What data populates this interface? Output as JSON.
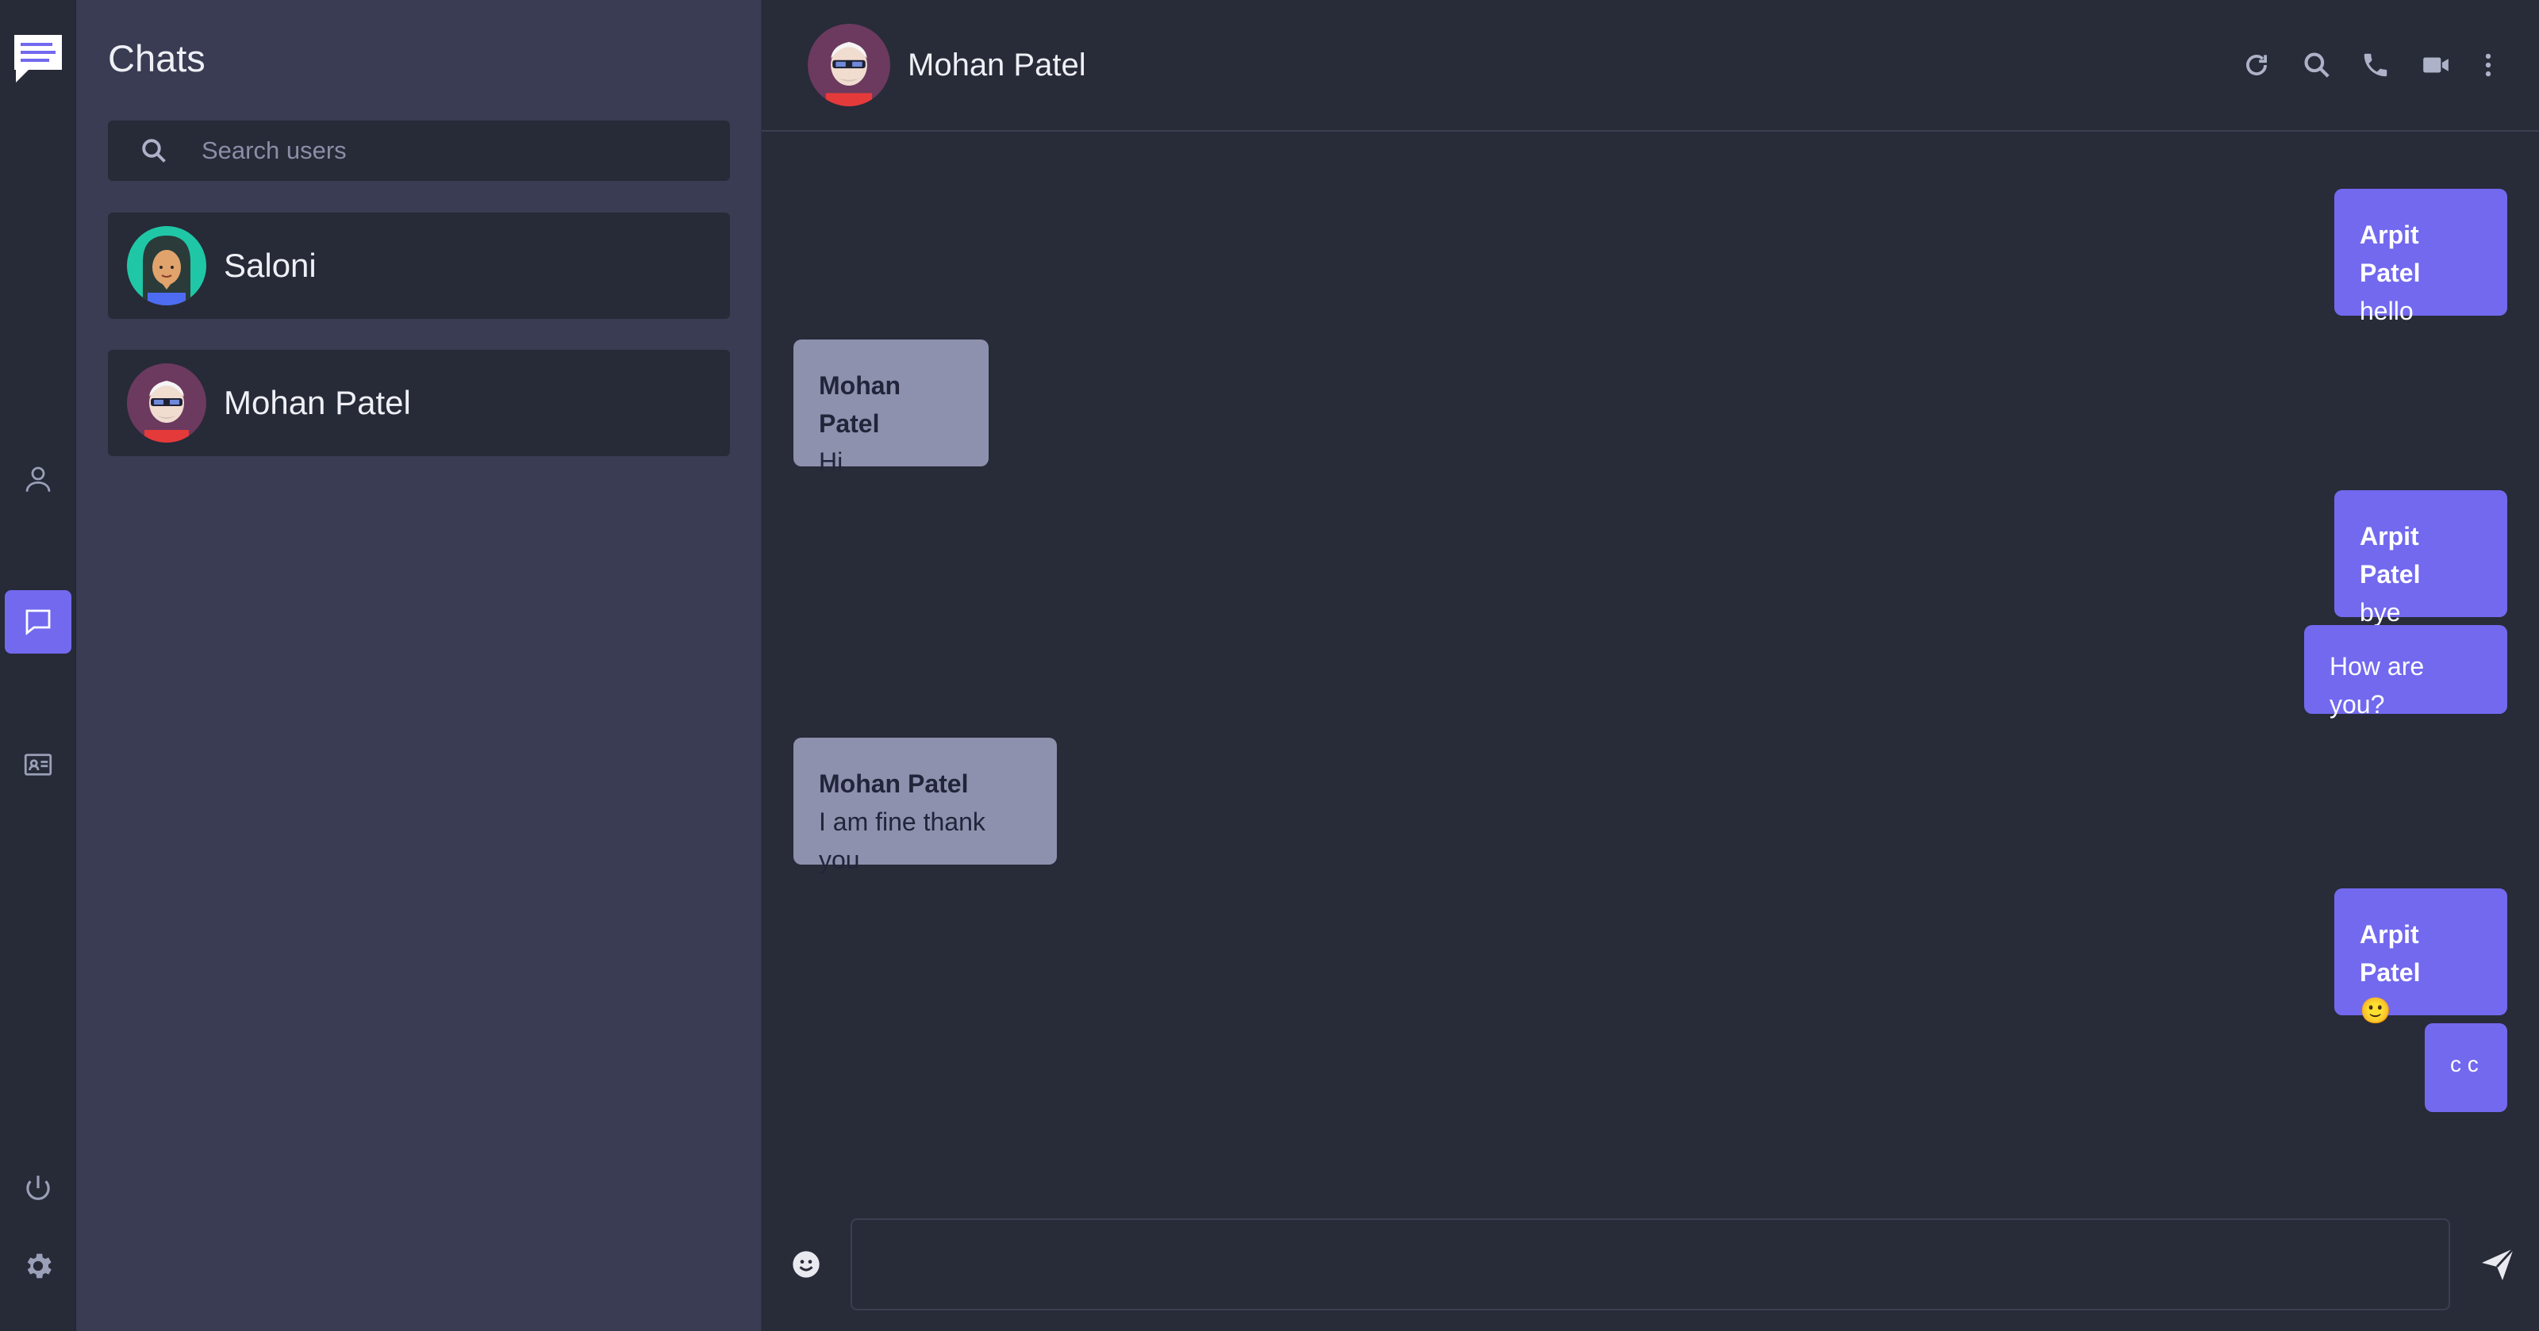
{
  "sidebar_rail": {
    "logo": "chat-logo-icon",
    "items": [
      {
        "icon": "user-icon",
        "active": false
      },
      {
        "icon": "chat-icon",
        "active": true
      },
      {
        "icon": "contacts-card-icon",
        "active": false
      },
      {
        "icon": "power-icon",
        "active": false
      },
      {
        "icon": "gear-icon",
        "active": false
      }
    ],
    "accent": "#7269ef"
  },
  "chat_list": {
    "title": "Chats",
    "search_placeholder": "Search users",
    "contacts": [
      {
        "name": "Saloni",
        "avatar": "avatar-female-icon"
      },
      {
        "name": "Mohan Patel",
        "avatar": "avatar-male-sunglasses-icon"
      }
    ]
  },
  "conversation": {
    "contact_name": "Mohan Patel",
    "header_icons": [
      "refresh-icon",
      "search-icon",
      "phone-icon",
      "video-icon",
      "more-vertical-icon"
    ],
    "messages": [
      {
        "direction": "out",
        "sender": "Arpit Patel",
        "text": "hello"
      },
      {
        "direction": "in",
        "sender": "Mohan Patel",
        "text": "Hi"
      },
      {
        "direction": "out",
        "sender": "Arpit Patel",
        "text": "bye"
      },
      {
        "direction": "out",
        "sender": "",
        "text": "How are you?"
      },
      {
        "direction": "in",
        "sender": "Mohan Patel",
        "text": "I am fine thank you"
      },
      {
        "direction": "out",
        "sender": "Arpit Patel",
        "text": "🙂"
      },
      {
        "direction": "out",
        "sender": "",
        "text": "c c"
      }
    ],
    "composer": {
      "value": "",
      "placeholder": ""
    },
    "colors": {
      "outgoing": "#7269ef",
      "incoming": "#8e91ad"
    }
  }
}
